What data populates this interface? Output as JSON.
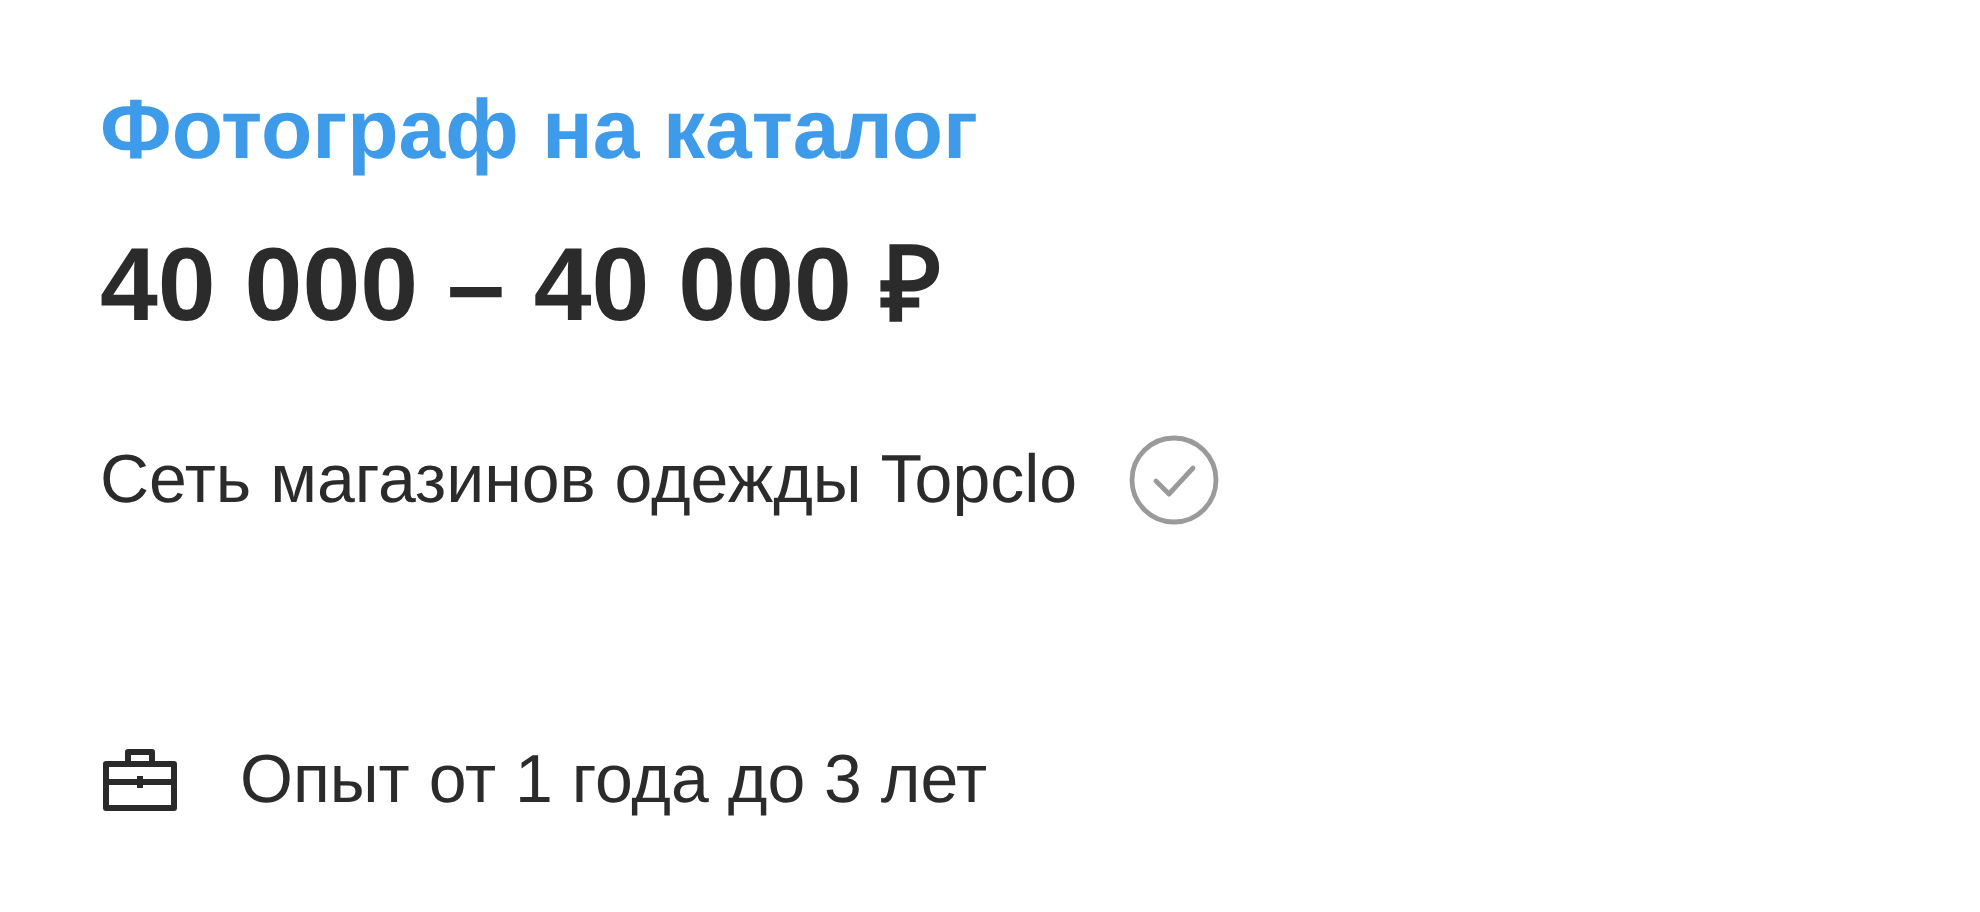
{
  "vacancy": {
    "title": "Фотограф на каталог",
    "salary": "40 000 – 40 000 ₽",
    "company": {
      "name": "Сеть магазинов одежды Topclo",
      "verified": true
    },
    "experience": "Опыт от 1 года до 3 лет"
  }
}
